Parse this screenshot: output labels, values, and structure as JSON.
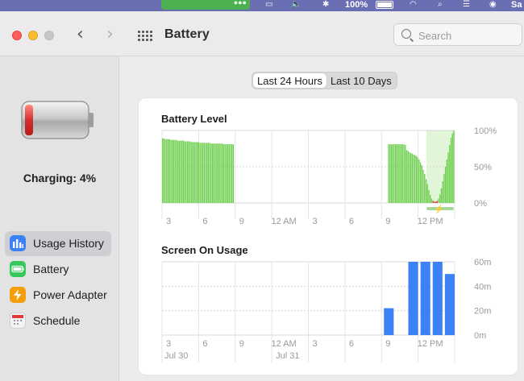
{
  "menubar": {
    "battery_percent": "100%",
    "user_initials": "Sa",
    "icons": [
      "screen-mirroring-icon",
      "volume-icon",
      "bluetooth-icon",
      "battery-icon",
      "wifi-icon",
      "spotlight-icon",
      "control-center-icon",
      "siri-icon"
    ]
  },
  "window": {
    "title": "Battery",
    "search_placeholder": "Search",
    "traffic_lights": {
      "close": "#ff5f57",
      "minimize": "#febc2e",
      "zoom": "#c8c8c8"
    }
  },
  "sidebar": {
    "charging_text": "Charging: 4%",
    "items": [
      {
        "label": "Usage History",
        "icon": "usage-history-icon",
        "color": "#3b82f6",
        "selected": true
      },
      {
        "label": "Battery",
        "icon": "battery-icon",
        "color": "#34c759",
        "selected": false
      },
      {
        "label": "Power Adapter",
        "icon": "bolt-icon",
        "color": "#f59e0b",
        "selected": false
      },
      {
        "label": "Schedule",
        "icon": "calendar-icon",
        "color": "#e5e5e5",
        "selected": false
      }
    ]
  },
  "segmented": {
    "options": [
      "Last 24 Hours",
      "Last 10 Days"
    ],
    "selected": "Last 24 Hours"
  },
  "colors": {
    "battery_bar": "#6fcf4f",
    "screen_bar": "#3b82f6",
    "charging_band": "#d9f3d0",
    "low_battery": "#e53935"
  },
  "chart_data": [
    {
      "type": "bar",
      "title": "Battery Level",
      "x_tick_labels": [
        "3",
        "6",
        "9",
        "12 AM",
        "3",
        "6",
        "9",
        "12 PM"
      ],
      "y_tick_labels": [
        "100%",
        "50%",
        "0%"
      ],
      "ylim": [
        0,
        100
      ],
      "grid": true,
      "values": [
        89,
        89,
        88,
        88,
        88,
        88,
        87,
        87,
        87,
        87,
        87,
        86,
        86,
        86,
        86,
        86,
        85,
        85,
        85,
        85,
        85,
        84,
        84,
        84,
        84,
        84,
        84,
        83,
        83,
        83,
        83,
        83,
        83,
        83,
        83,
        82,
        82,
        82,
        82,
        82,
        82,
        82,
        82,
        82,
        81,
        81,
        81,
        81,
        81,
        81,
        81,
        81,
        null,
        null,
        null,
        null,
        null,
        null,
        null,
        null,
        null,
        null,
        null,
        null,
        null,
        null,
        null,
        null,
        null,
        null,
        null,
        null,
        null,
        null,
        null,
        null,
        null,
        null,
        null,
        null,
        null,
        null,
        null,
        null,
        null,
        null,
        null,
        null,
        null,
        null,
        null,
        null,
        null,
        null,
        null,
        null,
        null,
        null,
        null,
        null,
        null,
        null,
        null,
        null,
        null,
        null,
        null,
        null,
        null,
        null,
        null,
        null,
        null,
        null,
        null,
        null,
        null,
        null,
        null,
        null,
        null,
        null,
        null,
        null,
        null,
        null,
        null,
        null,
        null,
        null,
        null,
        null,
        null,
        null,
        null,
        null,
        null,
        null,
        null,
        null,
        null,
        null,
        null,
        null,
        null,
        null,
        null,
        null,
        null,
        null,
        null,
        null,
        null,
        null,
        null,
        null,
        null,
        null,
        null,
        null,
        null,
        null,
        null,
        81,
        81,
        81,
        81,
        81,
        81,
        81,
        81,
        81,
        81,
        81,
        81,
        80,
        73,
        72,
        70,
        69,
        68,
        67,
        66,
        65,
        63,
        60,
        56,
        52,
        46,
        40,
        33,
        26,
        18,
        11,
        6,
        3,
        2,
        2,
        3,
        6,
        12,
        20,
        30,
        40,
        50,
        60,
        70,
        80,
        90,
        96,
        100
      ],
      "charging_segment": true
    },
    {
      "type": "bar",
      "title": "Screen On Usage",
      "x_tick_labels": [
        "3",
        "6",
        "9",
        "12 AM",
        "3",
        "6",
        "9",
        "12 PM"
      ],
      "date_labels": [
        "Jul 30",
        "Jul 31"
      ],
      "y_tick_labels": [
        "60m",
        "40m",
        "20m",
        "0m"
      ],
      "ylim": [
        0,
        60
      ],
      "grid": true,
      "bars": [
        {
          "hour_index": 19,
          "minutes": 22
        },
        {
          "hour_index": 21,
          "minutes": 60
        },
        {
          "hour_index": 22,
          "minutes": 60
        },
        {
          "hour_index": 23,
          "minutes": 60
        },
        {
          "hour_index": 24,
          "minutes": 50
        }
      ]
    }
  ]
}
